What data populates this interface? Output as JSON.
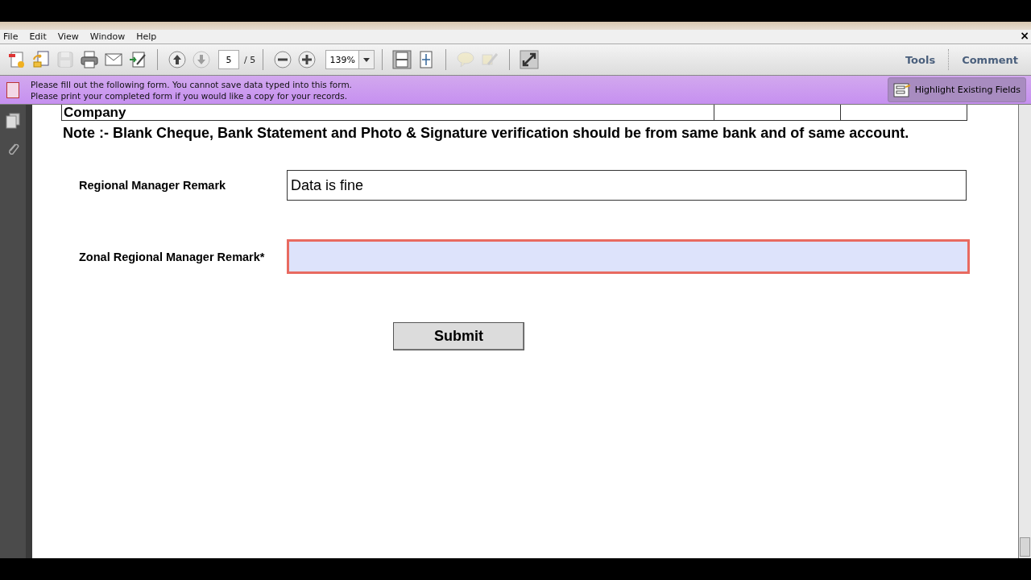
{
  "menu": [
    "File",
    "Edit",
    "View",
    "Window",
    "Help"
  ],
  "window_close": "×",
  "toolbar": {
    "icons": [
      {
        "kind": "create",
        "disabled": false
      },
      {
        "kind": "open",
        "disabled": false
      },
      {
        "kind": "save",
        "disabled": true
      },
      {
        "kind": "print",
        "disabled": false
      },
      {
        "kind": "mail",
        "disabled": false
      },
      {
        "kind": "sign",
        "disabled": false
      },
      {
        "kind": "up",
        "disabled": false
      },
      {
        "kind": "down",
        "disabled": true
      }
    ],
    "page_number": "5",
    "page_total": "/ 5",
    "zoom_icons": [
      {
        "kind": "minus",
        "disabled": false
      },
      {
        "kind": "plus",
        "disabled": false
      }
    ],
    "zoom": "139%",
    "view_icons": [
      {
        "kind": "fitpage",
        "disabled": false
      },
      {
        "kind": "fitwidth",
        "disabled": false
      },
      {
        "kind": "comment",
        "disabled": true
      },
      {
        "kind": "highlight",
        "disabled": true
      },
      {
        "kind": "fullscreen",
        "disabled": false
      }
    ],
    "panes": [
      "Tools",
      "Comment"
    ]
  },
  "notice": {
    "lines": [
      "Please fill out the following form. You cannot save data typed into this form.",
      "Please print your completed form if you would like a copy for your records."
    ],
    "button": "Highlight Existing Fields"
  },
  "document": {
    "table_cell": "Company",
    "note": "Note :- Blank Cheque, Bank Statement and Photo & Signature verification should be from same bank and of same account.",
    "fields": [
      {
        "label": "Regional Manager Remark",
        "value": "Data is fine",
        "highlighted": false
      },
      {
        "label": "Zonal Regional Manager Remark*",
        "highlighted": true
      }
    ],
    "submit": "Submit"
  }
}
